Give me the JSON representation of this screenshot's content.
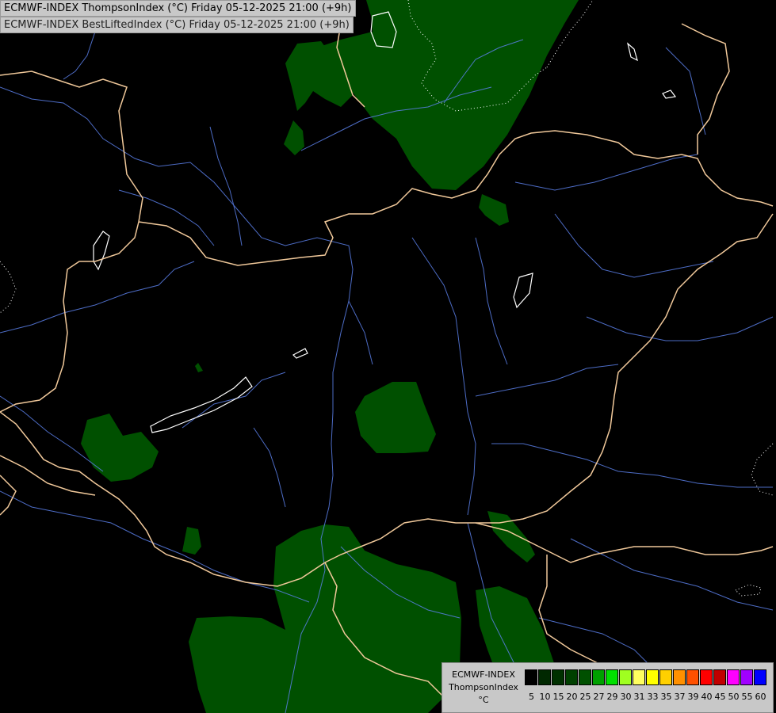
{
  "map": {
    "title_line_1": "ECMWF-INDEX ThompsonIndex (°C) Friday 05-12-2025 21:00 (+9h)",
    "title_line_2": "ECMWF-INDEX BestLiftedIndex (°C) Friday 05-12-2025 21:00 (+9h)",
    "colors": {
      "background": "#000000",
      "border": "#f0c89a",
      "river": "#5b7fe8",
      "lake": "#ffffff",
      "field": "#005000"
    }
  },
  "legend": {
    "line_1": "ECMWF-INDEX",
    "line_2": "ThompsonIndex",
    "unit": "°C",
    "classes": [
      {
        "label": "5",
        "color": "#000000"
      },
      {
        "label": "10",
        "color": "#002800"
      },
      {
        "label": "15",
        "color": "#003000"
      },
      {
        "label": "20",
        "color": "#004000"
      },
      {
        "label": "25",
        "color": "#005000"
      },
      {
        "label": "27",
        "color": "#00a000"
      },
      {
        "label": "29",
        "color": "#00e000"
      },
      {
        "label": "30",
        "color": "#a0ff20"
      },
      {
        "label": "31",
        "color": "#ffff60"
      },
      {
        "label": "33",
        "color": "#ffff00"
      },
      {
        "label": "35",
        "color": "#ffd000"
      },
      {
        "label": "37",
        "color": "#ff9000"
      },
      {
        "label": "39",
        "color": "#ff5000"
      },
      {
        "label": "40",
        "color": "#ff0000"
      },
      {
        "label": "45",
        "color": "#c00000"
      },
      {
        "label": "50",
        "color": "#ff00ff"
      },
      {
        "label": "55",
        "color": "#a000ff"
      },
      {
        "label": "60",
        "color": "#0000ff"
      }
    ]
  }
}
